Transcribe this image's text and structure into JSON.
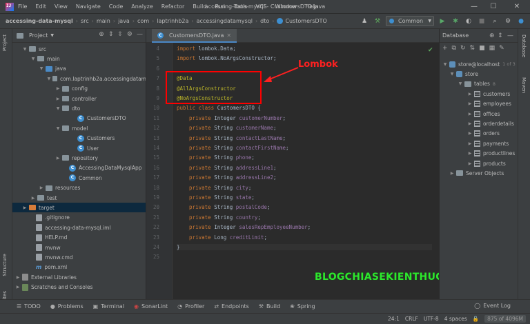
{
  "window": {
    "menu": [
      "File",
      "Edit",
      "View",
      "Navigate",
      "Code",
      "Analyze",
      "Refactor",
      "Build",
      "Run",
      "Tools",
      "VCS",
      "Window",
      "Help"
    ],
    "title": "accessing-data-mysql - CustomersDTO.java",
    "minimize": "—",
    "maximize": "☐",
    "close": "✕"
  },
  "breadcrumb": [
    "accessing-data-mysql",
    "src",
    "main",
    "java",
    "com",
    "laptrinhb2a",
    "accessingdatamysql",
    "dto",
    "CustomersDTO"
  ],
  "toolbar": {
    "run_config": "Common"
  },
  "left_strip": {
    "project_tab": "Project",
    "structure_tab": "Structure",
    "favorites_tab": "Favorites"
  },
  "project_panel": {
    "title": "Project",
    "tree": [
      {
        "label": "src",
        "depth": 1,
        "arrow": "▼",
        "icon": "folder",
        "indent": 14
      },
      {
        "label": "main",
        "depth": 2,
        "arrow": "▼",
        "icon": "folder",
        "indent": 26
      },
      {
        "label": "java",
        "depth": 3,
        "arrow": "▼",
        "icon": "folder-blue",
        "indent": 38
      },
      {
        "label": "com.laptrinhb2a.accessingdatam",
        "depth": 4,
        "arrow": "▼",
        "icon": "pkg",
        "indent": 50
      },
      {
        "label": "config",
        "depth": 5,
        "arrow": "›",
        "icon": "pkg",
        "indent": 62
      },
      {
        "label": "controller",
        "depth": 5,
        "arrow": "›",
        "icon": "pkg",
        "indent": 62
      },
      {
        "label": "dto",
        "depth": 5,
        "arrow": "▼",
        "icon": "pkg",
        "indent": 62
      },
      {
        "label": "CustomersDTO",
        "depth": 6,
        "arrow": "",
        "icon": "class",
        "indent": 84
      },
      {
        "label": "model",
        "depth": 5,
        "arrow": "▼",
        "icon": "pkg",
        "indent": 62
      },
      {
        "label": "Customers",
        "depth": 6,
        "arrow": "",
        "icon": "class",
        "indent": 84
      },
      {
        "label": "User",
        "depth": 6,
        "arrow": "",
        "icon": "class",
        "indent": 84
      },
      {
        "label": "repository",
        "depth": 5,
        "arrow": "›",
        "icon": "pkg",
        "indent": 62
      },
      {
        "label": "AccessingDataMysqlApp",
        "depth": 5,
        "arrow": "",
        "icon": "class",
        "indent": 72
      },
      {
        "label": "Common",
        "depth": 5,
        "arrow": "",
        "icon": "class",
        "indent": 72
      },
      {
        "label": "resources",
        "depth": 3,
        "arrow": "›",
        "icon": "folder",
        "indent": 38
      },
      {
        "label": "test",
        "depth": 2,
        "arrow": "›",
        "icon": "folder",
        "indent": 26
      },
      {
        "label": "target",
        "depth": 1,
        "arrow": "›",
        "icon": "folder-orange",
        "indent": 14,
        "selected": true
      },
      {
        "label": ".gitignore",
        "depth": 1,
        "arrow": "",
        "icon": "file",
        "indent": 24
      },
      {
        "label": "accessing-data-mysql.iml",
        "depth": 1,
        "arrow": "",
        "icon": "file",
        "indent": 24
      },
      {
        "label": "HELP.md",
        "depth": 1,
        "arrow": "",
        "icon": "file",
        "indent": 24
      },
      {
        "label": "mvnw",
        "depth": 1,
        "arrow": "",
        "icon": "file",
        "indent": 24
      },
      {
        "label": "mvnw.cmd",
        "depth": 1,
        "arrow": "",
        "icon": "file",
        "indent": 24
      },
      {
        "label": "pom.xml",
        "depth": 1,
        "arrow": "",
        "icon": "maven",
        "indent": 24
      },
      {
        "label": "External Libraries",
        "depth": 0,
        "arrow": "›",
        "icon": "lib",
        "indent": 4
      },
      {
        "label": "Scratches and Consoles",
        "depth": 0,
        "arrow": "›",
        "icon": "scratch",
        "indent": 4
      }
    ]
  },
  "editor": {
    "tab": "CustomersDTO.java",
    "lines": [
      {
        "n": "4",
        "tokens": [
          [
            "kw",
            "import "
          ],
          [
            "cls",
            "lombok.Data;"
          ]
        ]
      },
      {
        "n": "5",
        "tokens": [
          [
            "kw",
            "import "
          ],
          [
            "cls",
            "lombok.NoArgsConstructor;"
          ]
        ]
      },
      {
        "n": "6",
        "tokens": []
      },
      {
        "n": "7",
        "tokens": [
          [
            "ann",
            "@Data"
          ]
        ]
      },
      {
        "n": "8",
        "tokens": [
          [
            "ann",
            "@AllArgsConstructor"
          ]
        ]
      },
      {
        "n": "9",
        "tokens": [
          [
            "ann",
            "@NoArgsConstructor"
          ]
        ]
      },
      {
        "n": "10",
        "tokens": [
          [
            "kw",
            "public class "
          ],
          [
            "cls",
            "CustomersDTO {"
          ]
        ]
      },
      {
        "n": "11",
        "tokens": [
          [
            "kw",
            "    private "
          ],
          [
            "cls",
            "Integer "
          ],
          [
            "fld",
            "customerNumber"
          ],
          [
            "cls",
            ";"
          ]
        ]
      },
      {
        "n": "12",
        "tokens": [
          [
            "kw",
            "    private "
          ],
          [
            "cls",
            "String "
          ],
          [
            "fld",
            "customerName"
          ],
          [
            "cls",
            ";"
          ]
        ]
      },
      {
        "n": "13",
        "tokens": [
          [
            "kw",
            "    private "
          ],
          [
            "cls",
            "String "
          ],
          [
            "fld",
            "contactLastName"
          ],
          [
            "cls",
            ";"
          ]
        ]
      },
      {
        "n": "14",
        "tokens": [
          [
            "kw",
            "    private "
          ],
          [
            "cls",
            "String "
          ],
          [
            "fld",
            "contactFirstName"
          ],
          [
            "cls",
            ";"
          ]
        ]
      },
      {
        "n": "15",
        "tokens": [
          [
            "kw",
            "    private "
          ],
          [
            "cls",
            "String "
          ],
          [
            "fld",
            "phone"
          ],
          [
            "cls",
            ";"
          ]
        ]
      },
      {
        "n": "16",
        "tokens": [
          [
            "kw",
            "    private "
          ],
          [
            "cls",
            "String "
          ],
          [
            "fld",
            "addressLine1"
          ],
          [
            "cls",
            ";"
          ]
        ]
      },
      {
        "n": "17",
        "tokens": [
          [
            "kw",
            "    private "
          ],
          [
            "cls",
            "String "
          ],
          [
            "fld",
            "addressLine2"
          ],
          [
            "cls",
            ";"
          ]
        ]
      },
      {
        "n": "18",
        "tokens": [
          [
            "kw",
            "    private "
          ],
          [
            "cls",
            "String "
          ],
          [
            "fld",
            "city"
          ],
          [
            "cls",
            ";"
          ]
        ]
      },
      {
        "n": "19",
        "tokens": [
          [
            "kw",
            "    private "
          ],
          [
            "cls",
            "String "
          ],
          [
            "fld",
            "state"
          ],
          [
            "cls",
            ";"
          ]
        ]
      },
      {
        "n": "20",
        "tokens": [
          [
            "kw",
            "    private "
          ],
          [
            "cls",
            "String "
          ],
          [
            "fld",
            "postalCode"
          ],
          [
            "cls",
            ";"
          ]
        ]
      },
      {
        "n": "21",
        "tokens": [
          [
            "kw",
            "    private "
          ],
          [
            "cls",
            "String "
          ],
          [
            "fld",
            "country"
          ],
          [
            "cls",
            ";"
          ]
        ]
      },
      {
        "n": "22",
        "tokens": [
          [
            "kw",
            "    private "
          ],
          [
            "cls",
            "Integer "
          ],
          [
            "fld",
            "salesRepEmployeeNumber"
          ],
          [
            "cls",
            ";"
          ]
        ]
      },
      {
        "n": "23",
        "tokens": [
          [
            "kw",
            "    private "
          ],
          [
            "cls",
            "Long "
          ],
          [
            "fld",
            "creditLimit"
          ],
          [
            "cls",
            ";"
          ]
        ]
      },
      {
        "n": "24",
        "tokens": [
          [
            "cls",
            "}"
          ]
        ]
      },
      {
        "n": "25",
        "tokens": []
      }
    ],
    "annotation_label": "Lombok",
    "watermark": "BLOGCHIASEKIENTHUC.COM"
  },
  "database_panel": {
    "title": "Database",
    "rows": [
      {
        "label": "store@localhost",
        "badge": "1 of 3",
        "arrow": "▼",
        "icon": "db",
        "indent": 4
      },
      {
        "label": "store",
        "badge": "",
        "arrow": "▼",
        "icon": "db",
        "indent": 14
      },
      {
        "label": "tables",
        "badge": "8",
        "arrow": "▼",
        "icon": "folder",
        "indent": 26
      },
      {
        "label": "customers",
        "badge": "",
        "arrow": "›",
        "icon": "table",
        "indent": 40
      },
      {
        "label": "employees",
        "badge": "",
        "arrow": "›",
        "icon": "table",
        "indent": 40
      },
      {
        "label": "offices",
        "badge": "",
        "arrow": "›",
        "icon": "table",
        "indent": 40
      },
      {
        "label": "orderdetails",
        "badge": "",
        "arrow": "›",
        "icon": "table",
        "indent": 40
      },
      {
        "label": "orders",
        "badge": "",
        "arrow": "›",
        "icon": "table",
        "indent": 40
      },
      {
        "label": "payments",
        "badge": "",
        "arrow": "›",
        "icon": "table",
        "indent": 40
      },
      {
        "label": "productlines",
        "badge": "",
        "arrow": "›",
        "icon": "table",
        "indent": 40
      },
      {
        "label": "products",
        "badge": "",
        "arrow": "›",
        "icon": "table",
        "indent": 40
      },
      {
        "label": "Server Objects",
        "badge": "",
        "arrow": "›",
        "icon": "folder",
        "indent": 14
      }
    ]
  },
  "right_strip": {
    "database_tab": "Database",
    "maven_tab": "Maven"
  },
  "bottom_tools": [
    {
      "label": "TODO",
      "icon": "☰"
    },
    {
      "label": "Problems",
      "icon": "●"
    },
    {
      "label": "Terminal",
      "icon": "▣"
    },
    {
      "label": "SonarLint",
      "icon": "◉"
    },
    {
      "label": "Profiler",
      "icon": "◔"
    },
    {
      "label": "Endpoints",
      "icon": "⇄"
    },
    {
      "label": "Build",
      "icon": "⚒"
    },
    {
      "label": "Spring",
      "icon": "❀"
    }
  ],
  "event_log": "Event Log",
  "status": {
    "position": "24:1",
    "line_sep": "CRLF",
    "encoding": "UTF-8",
    "indent": "4 spaces",
    "memory": "875 of 4096M"
  }
}
